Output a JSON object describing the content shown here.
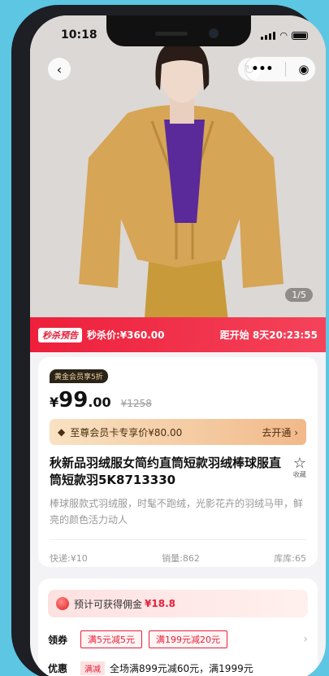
{
  "status": {
    "time": "10:18"
  },
  "gallery": {
    "counter": "1/5"
  },
  "flash_sale": {
    "tag": "秒杀预告",
    "price": "秒杀价:¥360.00",
    "countdown": "距开始 8天20:23:55"
  },
  "product": {
    "vip_badge": "黄金会员享5折",
    "price_symbol": "¥",
    "price_int": "99",
    "price_dec": ".00",
    "original_price": "¥1258",
    "member_card_text": "至尊会员卡专享价¥80.00",
    "member_card_action": "去开通 ›",
    "title": "秋新品羽绒服女简约直筒短款羽绒棒球服直筒短款羽5K8713330",
    "favorite_label": "收藏",
    "description": "棒球服款式羽绒服，时髦不跑绒，光影花卉的羽绒马甲，鲜亮的颜色活力动人",
    "shipping": "快递:¥10",
    "sales": "销量:862",
    "stock": "库库:65"
  },
  "commission": {
    "text": "预计可获得佣金",
    "value": "¥18.8"
  },
  "coupons": {
    "label": "领券",
    "items": [
      "满5元减5元",
      "满199元减20元"
    ]
  },
  "promo": {
    "label": "优惠",
    "tag": "满减",
    "text": "全场满899元减60元，满1999元"
  }
}
